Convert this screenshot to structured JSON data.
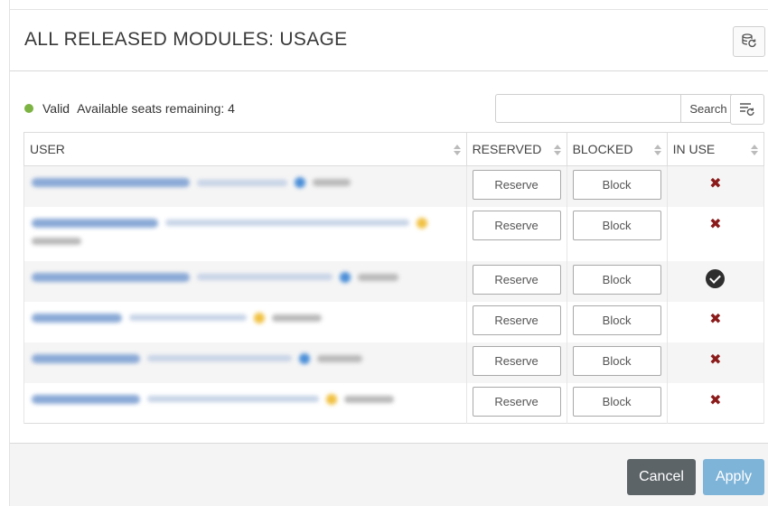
{
  "dialog": {
    "title": "ALL RELEASED MODULES: USAGE"
  },
  "status": {
    "state": "Valid",
    "message": "Available seats remaining: 4",
    "color": "#7cb342"
  },
  "search": {
    "value": "",
    "placeholder": "",
    "button_label": "Search"
  },
  "table": {
    "columns": [
      "USER",
      "RESERVED",
      "BLOCKED",
      "IN USE"
    ],
    "rows": [
      {
        "reserve_label": "Reserve",
        "block_label": "Block",
        "in_use": false,
        "icon": "x-icon"
      },
      {
        "reserve_label": "Reserve",
        "block_label": "Block",
        "in_use": false,
        "icon": "x-icon"
      },
      {
        "reserve_label": "Reserve",
        "block_label": "Block",
        "in_use": true,
        "icon": "check-circle-icon"
      },
      {
        "reserve_label": "Reserve",
        "block_label": "Block",
        "in_use": false,
        "icon": "x-icon"
      },
      {
        "reserve_label": "Reserve",
        "block_label": "Block",
        "in_use": false,
        "icon": "x-icon"
      },
      {
        "reserve_label": "Reserve",
        "block_label": "Block",
        "in_use": false,
        "icon": "x-icon"
      }
    ]
  },
  "footer": {
    "cancel_label": "Cancel",
    "apply_label": "Apply"
  },
  "colors": {
    "cancel": "#5c6468",
    "apply": "#7fb4d9",
    "not_in_use": "#8b1a1a"
  },
  "icons": {
    "header_button": "database-refresh-icon",
    "filter_button": "filter-reset-icon"
  }
}
